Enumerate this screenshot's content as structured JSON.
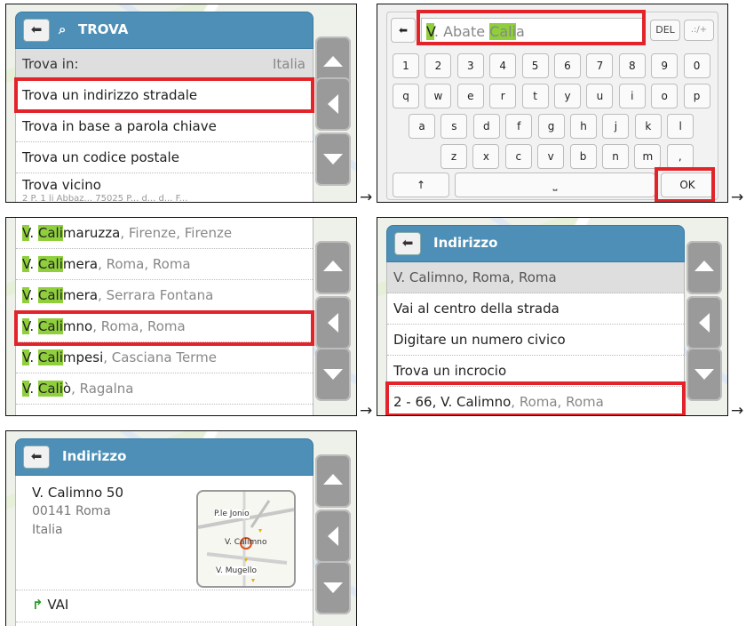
{
  "arrow_glyph": "→",
  "panel1": {
    "title": "TROVA",
    "trova_in_label": "Trova in:",
    "trova_in_value": "Italia",
    "items": [
      "Trova un indirizzo stradale",
      "Trova in base a parola chiave",
      "Trova un codice postale",
      "Trova vicino"
    ],
    "partial_row": "2 P. 1 li Abbaz... 75025 P... d... d... F..."
  },
  "panel2": {
    "input_prefix_hl": "V",
    "input_mid": ". Abate ",
    "input_hl": "Cali",
    "input_suffix": "a",
    "del_label": "DEL",
    "sym_label": ".:/+",
    "row1": [
      "1",
      "2",
      "3",
      "4",
      "5",
      "6",
      "7",
      "8",
      "9",
      "0"
    ],
    "row2": [
      "q",
      "w",
      "e",
      "r",
      "t",
      "y",
      "u",
      "i",
      "o",
      "p"
    ],
    "row3": [
      "a",
      "s",
      "d",
      "f",
      "g",
      "h",
      "j",
      "k",
      "l"
    ],
    "row4": [
      "z",
      "x",
      "c",
      "v",
      "b",
      "n",
      "m",
      ","
    ],
    "shift_glyph": "↑",
    "space_glyph": "⎵",
    "ok_label": "OK"
  },
  "panel3": {
    "results": [
      {
        "hl_a": "V",
        "mid": ". ",
        "hl_b": "Cali",
        "rest": "maruzza",
        "place": ", Firenze, Firenze"
      },
      {
        "hl_a": "V",
        "mid": ". ",
        "hl_b": "Cali",
        "rest": "mera",
        "place": ", Roma, Roma"
      },
      {
        "hl_a": "V",
        "mid": ". ",
        "hl_b": "Cali",
        "rest": "mera",
        "place": ", Serrara Fontana"
      },
      {
        "hl_a": "V",
        "mid": ". ",
        "hl_b": "Cali",
        "rest": "mno",
        "place": ", Roma, Roma"
      },
      {
        "hl_a": "V",
        "mid": ". ",
        "hl_b": "Cali",
        "rest": "mpesi",
        "place": ", Casciana Terme"
      },
      {
        "hl_a": "V",
        "mid": ". ",
        "hl_b": "Cali",
        "rest": "ò",
        "place": ", Ragalna"
      }
    ]
  },
  "panel4": {
    "title": "Indirizzo",
    "address": "V. Calimno, Roma, Roma",
    "items": [
      "Vai al centro della strada",
      "Digitare un numero civico",
      "Trova un incrocio"
    ],
    "range_bold": "2 - 66, V. Calimno",
    "range_rest": ", Roma, Roma"
  },
  "panel5": {
    "title": "Indirizzo",
    "street": "V. Calimno 50",
    "postal_city": "00141 Roma",
    "country": "Italia",
    "map_label_top": "P.le Jonio",
    "map_label_mid": "V. Calimno",
    "map_label_bot": "V. Mugello",
    "go_label": "VAI"
  },
  "colors": {
    "header_blue": "#4d8fb7",
    "highlight_green": "#8fcf3c",
    "annotation_red": "#e2242a"
  }
}
